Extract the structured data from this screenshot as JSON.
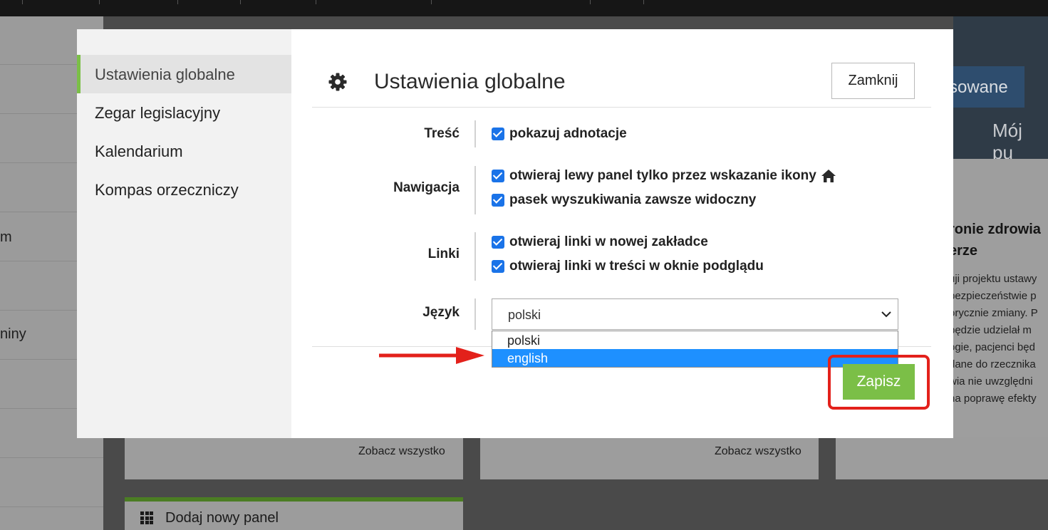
{
  "background": {
    "left_nav_fragments": [
      "m",
      "niny"
    ],
    "hero_button_label": "sowane",
    "hero_subtitle": "Mój pu",
    "article_title_line1": "ronie zdrowia",
    "article_title_line2": "erze",
    "article_lines": [
      "uji projektu ustawy",
      "bezpieczeństwie p",
      "orycznie zmiany. P",
      "będzie udzielał m",
      "ogie, pacjenci będ",
      "dane do rzecznika",
      "wia nie uwzględni",
      "na poprawę efekty"
    ],
    "see_all_label": "Zobacz wszystko",
    "add_panel_label": "Dodaj nowy panel"
  },
  "modal": {
    "sidebar": {
      "items": [
        {
          "label": "Ustawienia globalne",
          "active": true
        },
        {
          "label": "Zegar legislacyjny",
          "active": false
        },
        {
          "label": "Kalendarium",
          "active": false
        },
        {
          "label": "Kompas orzeczniczy",
          "active": false
        }
      ]
    },
    "title": "Ustawienia globalne",
    "title_icon": "gear-icon",
    "close_label": "Zamknij",
    "sections": {
      "content": {
        "label": "Treść",
        "options": [
          {
            "label": "pokazuj adnotacje",
            "checked": true
          }
        ]
      },
      "navigation": {
        "label": "Nawigacja",
        "options": [
          {
            "label": "otwieraj lewy panel tylko przez wskazanie ikony",
            "checked": true,
            "icon": "home-icon"
          },
          {
            "label": "pasek wyszukiwania zawsze widoczny",
            "checked": true
          }
        ]
      },
      "links": {
        "label": "Linki",
        "options": [
          {
            "label": "otwieraj linki w nowej zakładce",
            "checked": true
          },
          {
            "label": "otwieraj linki w treści w oknie podglądu",
            "checked": true
          }
        ]
      },
      "language": {
        "label": "Język",
        "selected": "polski",
        "options": [
          "polski",
          "english"
        ],
        "highlighted": "english"
      }
    },
    "save_label": "Zapisz"
  },
  "annotation": {
    "arrow_color": "#e3211b",
    "box_color": "#e3211b"
  },
  "colors": {
    "accent_green": "#7bbf47",
    "checkbox_blue": "#1a73e8",
    "dropdown_highlight": "#1e90ff"
  }
}
